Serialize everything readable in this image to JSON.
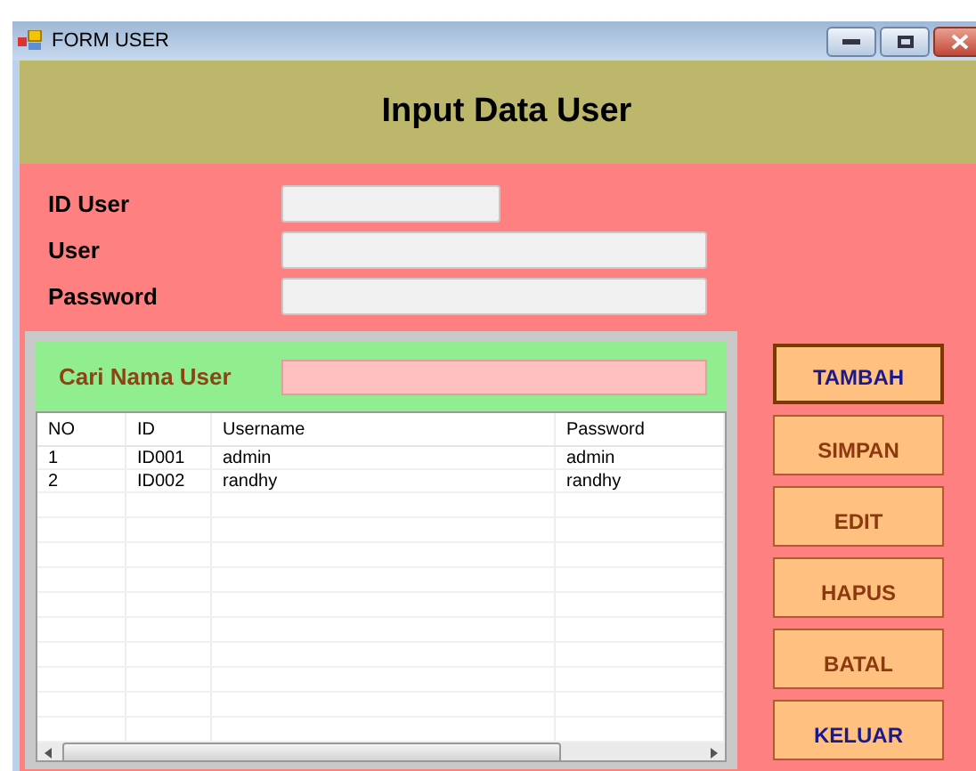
{
  "window": {
    "title": "FORM USER"
  },
  "header": {
    "title": "Input Data User"
  },
  "fields": [
    {
      "label": "ID User"
    },
    {
      "label": "User"
    },
    {
      "label": "Password"
    }
  ],
  "search": {
    "label": "Cari Nama User"
  },
  "table": {
    "columns": [
      "NO",
      "ID",
      "Username",
      "Password"
    ],
    "rows": [
      [
        "1",
        "ID001",
        "admin",
        "admin"
      ],
      [
        "2",
        "ID002",
        "randhy",
        "randhy"
      ]
    ]
  },
  "buttons": [
    {
      "label": "TAMBAH",
      "focused": true,
      "kind": "navigation"
    },
    {
      "label": "SIMPAN",
      "focused": false,
      "kind": "action"
    },
    {
      "label": "EDIT",
      "focused": false,
      "kind": "action"
    },
    {
      "label": "HAPUS",
      "focused": false,
      "kind": "action"
    },
    {
      "label": "BATAL",
      "focused": false,
      "kind": "action"
    },
    {
      "label": "KELUAR",
      "focused": false,
      "kind": "navigation"
    }
  ]
}
